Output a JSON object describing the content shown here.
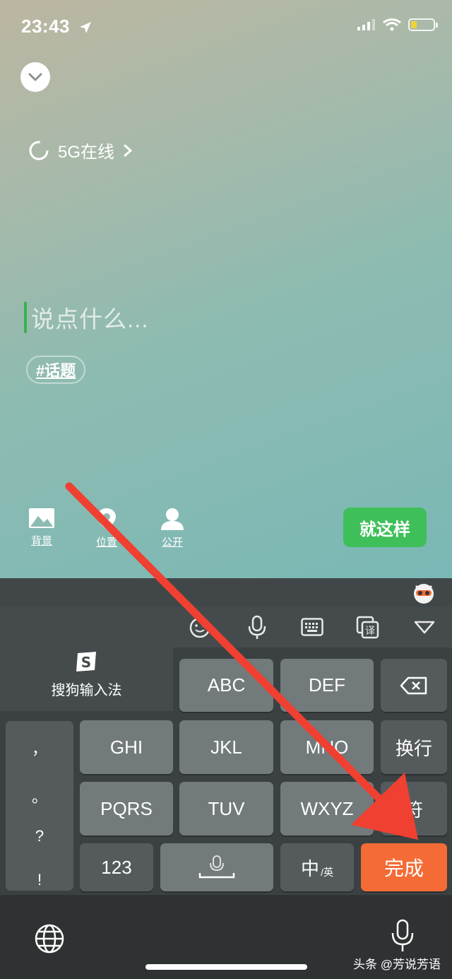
{
  "status_bar": {
    "time": "23:43"
  },
  "composer": {
    "network_status": "5G在线",
    "placeholder": "说点什么...",
    "topic_tag": "#话题",
    "tools": [
      {
        "label": "背景",
        "icon": "image-icon"
      },
      {
        "label": "位置",
        "icon": "location-pin-icon"
      },
      {
        "label": "公开",
        "icon": "person-icon"
      }
    ],
    "submit_label": "就这样"
  },
  "keyboard": {
    "brand_name": "搜狗输入法",
    "keys_row1": [
      "ABC",
      "DEF"
    ],
    "keys_row2": [
      "GHI",
      "JKL",
      "MNO",
      "换行"
    ],
    "keys_row3": [
      "PQRS",
      "TUV",
      "WXYZ",
      "符"
    ],
    "punctuation": [
      "，",
      "。",
      "?",
      "!"
    ],
    "num_key": "123",
    "lang_key_main": "中",
    "lang_key_sub": "英",
    "done_key": "完成"
  },
  "watermark": "头条 @芳说芳语",
  "colors": {
    "submit_green": "#3fbf5a",
    "done_orange": "#f46b35",
    "caret_green": "#3bb34a",
    "arrow_red": "#ef4031"
  }
}
